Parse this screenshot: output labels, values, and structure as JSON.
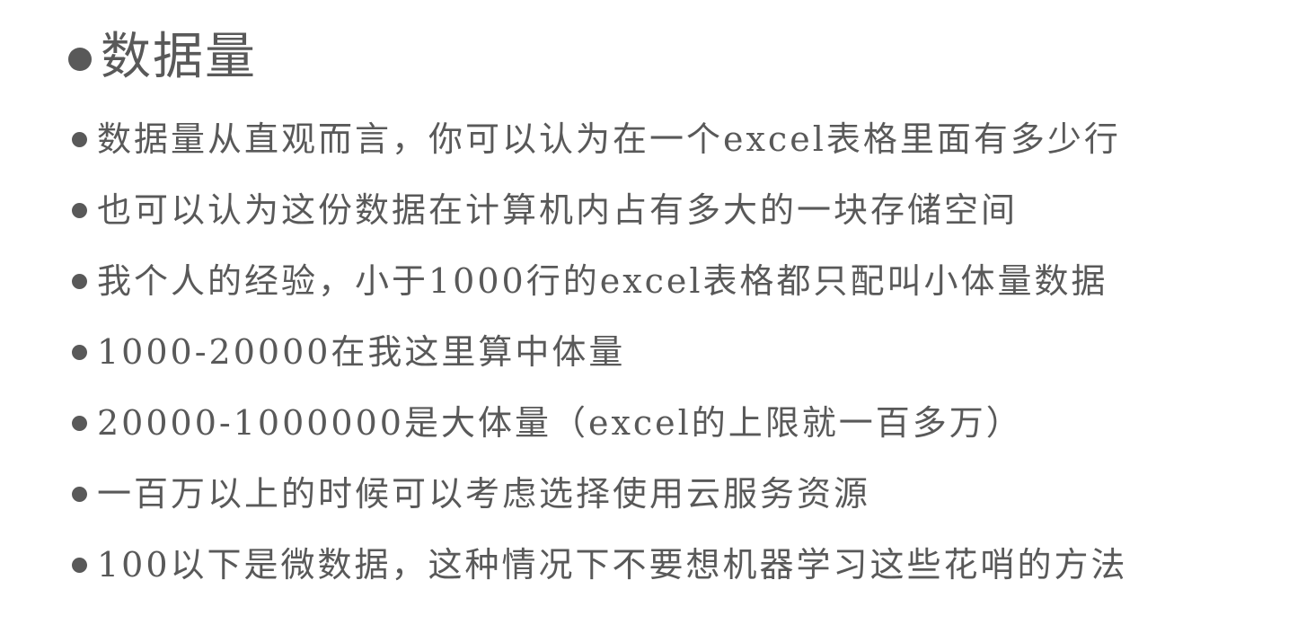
{
  "heading": {
    "title": "数据量"
  },
  "bullets": [
    "数据量从直观而言，你可以认为在一个excel表格里面有多少行",
    "也可以认为这份数据在计算机内占有多大的一块存储空间",
    "我个人的经验，小于1000行的excel表格都只配叫小体量数据",
    "1000-20000在我这里算中体量",
    "20000-1000000是大体量（excel的上限就一百多万）",
    "一百万以上的时候可以考虑选择使用云服务资源",
    "100以下是微数据，这种情况下不要想机器学习这些花哨的方法"
  ],
  "colors": {
    "text": "#595959",
    "background": "#ffffff"
  }
}
